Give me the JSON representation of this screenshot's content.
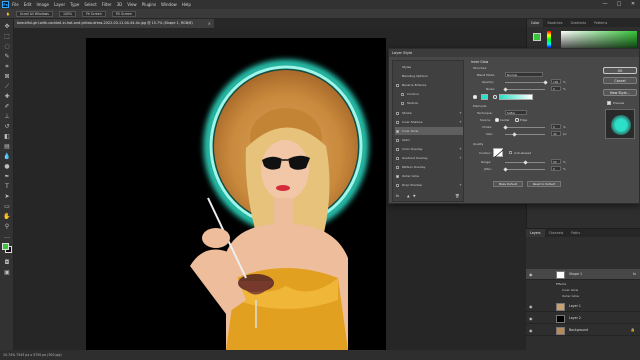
{
  "menu": {
    "logo": "Ps",
    "items": [
      "File",
      "Edit",
      "Image",
      "Layer",
      "Type",
      "Select",
      "Filter",
      "3D",
      "View",
      "Plugins",
      "Window",
      "Help"
    ]
  },
  "window_controls": {
    "minimize": "—",
    "maximize": "□",
    "close": "✕"
  },
  "options_bar": {
    "scroll_all": "Scroll All Windows",
    "zoom": "100%",
    "fit_screen": "Fit Screen",
    "fill_screen": "Fill Screen"
  },
  "document_tab": {
    "title": "beautiful-girl-with-cocktail-in-hat-and-yellow-dress-2022-03-11-04-44-4x.jpg @ 15.7% (Shape 1, RGB/8)",
    "close": "×"
  },
  "status_bar": {
    "text": "15.74%    7543 px x 5750 px (300 ppi)"
  },
  "color_panel": {
    "tabs": [
      "Color",
      "Swatches",
      "Gradients",
      "Patterns"
    ]
  },
  "layer_style": {
    "title": "Layer Style",
    "left_items": [
      {
        "label": "Styles",
        "checkbox": false,
        "checked": false,
        "plus": false,
        "selected": false
      },
      {
        "label": "Blending Options",
        "checkbox": false,
        "checked": false,
        "plus": false,
        "selected": false
      },
      {
        "label": "Bevel & Emboss",
        "checkbox": true,
        "checked": false,
        "plus": false,
        "selected": false
      },
      {
        "label": "Contour",
        "checkbox": true,
        "checked": false,
        "plus": false,
        "selected": false
      },
      {
        "label": "Texture",
        "checkbox": true,
        "checked": false,
        "plus": false,
        "selected": false
      },
      {
        "label": "Stroke",
        "checkbox": true,
        "checked": false,
        "plus": true,
        "selected": false
      },
      {
        "label": "Inner Shadow",
        "checkbox": true,
        "checked": false,
        "plus": true,
        "selected": false
      },
      {
        "label": "Inner Glow",
        "checkbox": true,
        "checked": true,
        "plus": false,
        "selected": true
      },
      {
        "label": "Satin",
        "checkbox": true,
        "checked": false,
        "plus": false,
        "selected": false
      },
      {
        "label": "Color Overlay",
        "checkbox": true,
        "checked": false,
        "plus": true,
        "selected": false
      },
      {
        "label": "Gradient Overlay",
        "checkbox": true,
        "checked": false,
        "plus": true,
        "selected": false
      },
      {
        "label": "Pattern Overlay",
        "checkbox": true,
        "checked": false,
        "plus": false,
        "selected": false
      },
      {
        "label": "Outer Glow",
        "checkbox": true,
        "checked": true,
        "plus": false,
        "selected": false
      },
      {
        "label": "Drop Shadow",
        "checkbox": true,
        "checked": false,
        "plus": true,
        "selected": false
      }
    ],
    "fx_label": "fx",
    "inner_glow": {
      "title": "Inner Glow",
      "structure": "Structure",
      "blend_mode_label": "Blend Mode:",
      "blend_mode": "Normal",
      "opacity_label": "Opacity:",
      "opacity": "100",
      "noise_label": "Noise:",
      "noise": "0",
      "percent": "%",
      "glow_color": "#2de0c8",
      "elements": "Elements",
      "technique_label": "Technique:",
      "technique": "Softer",
      "source_label": "Source:",
      "source_center": "Center",
      "source_edge": "Edge",
      "choke_label": "Choke:",
      "choke": "0",
      "size_label": "Size:",
      "size": "49",
      "px": "px",
      "quality": "Quality",
      "contour_label": "Contour:",
      "anti_aliased": "Anti-aliased",
      "range_label": "Range:",
      "range": "50",
      "jitter_label": "Jitter:",
      "jitter": "0",
      "make_default": "Make Default",
      "reset_default": "Reset to Default"
    },
    "buttons": {
      "ok": "OK",
      "cancel": "Cancel",
      "new_style": "New Style...",
      "preview": "Preview"
    }
  },
  "layers_panel": {
    "tabs": [
      "Layers",
      "Channels",
      "Paths"
    ],
    "rows": [
      {
        "name": "Shape 1",
        "selected": true
      },
      {
        "name": "Layer 1",
        "selected": false
      },
      {
        "name": "Layer 2",
        "selected": false
      },
      {
        "name": "Background",
        "selected": false
      }
    ],
    "effects_label": "Effects",
    "effects": [
      "Inner Glow",
      "Outer Glow"
    ]
  },
  "colors": {
    "accent_glow": "#2de0c8",
    "foreground": "#37c53a",
    "background_swatch": "#111111",
    "dress": "#e2a020"
  }
}
